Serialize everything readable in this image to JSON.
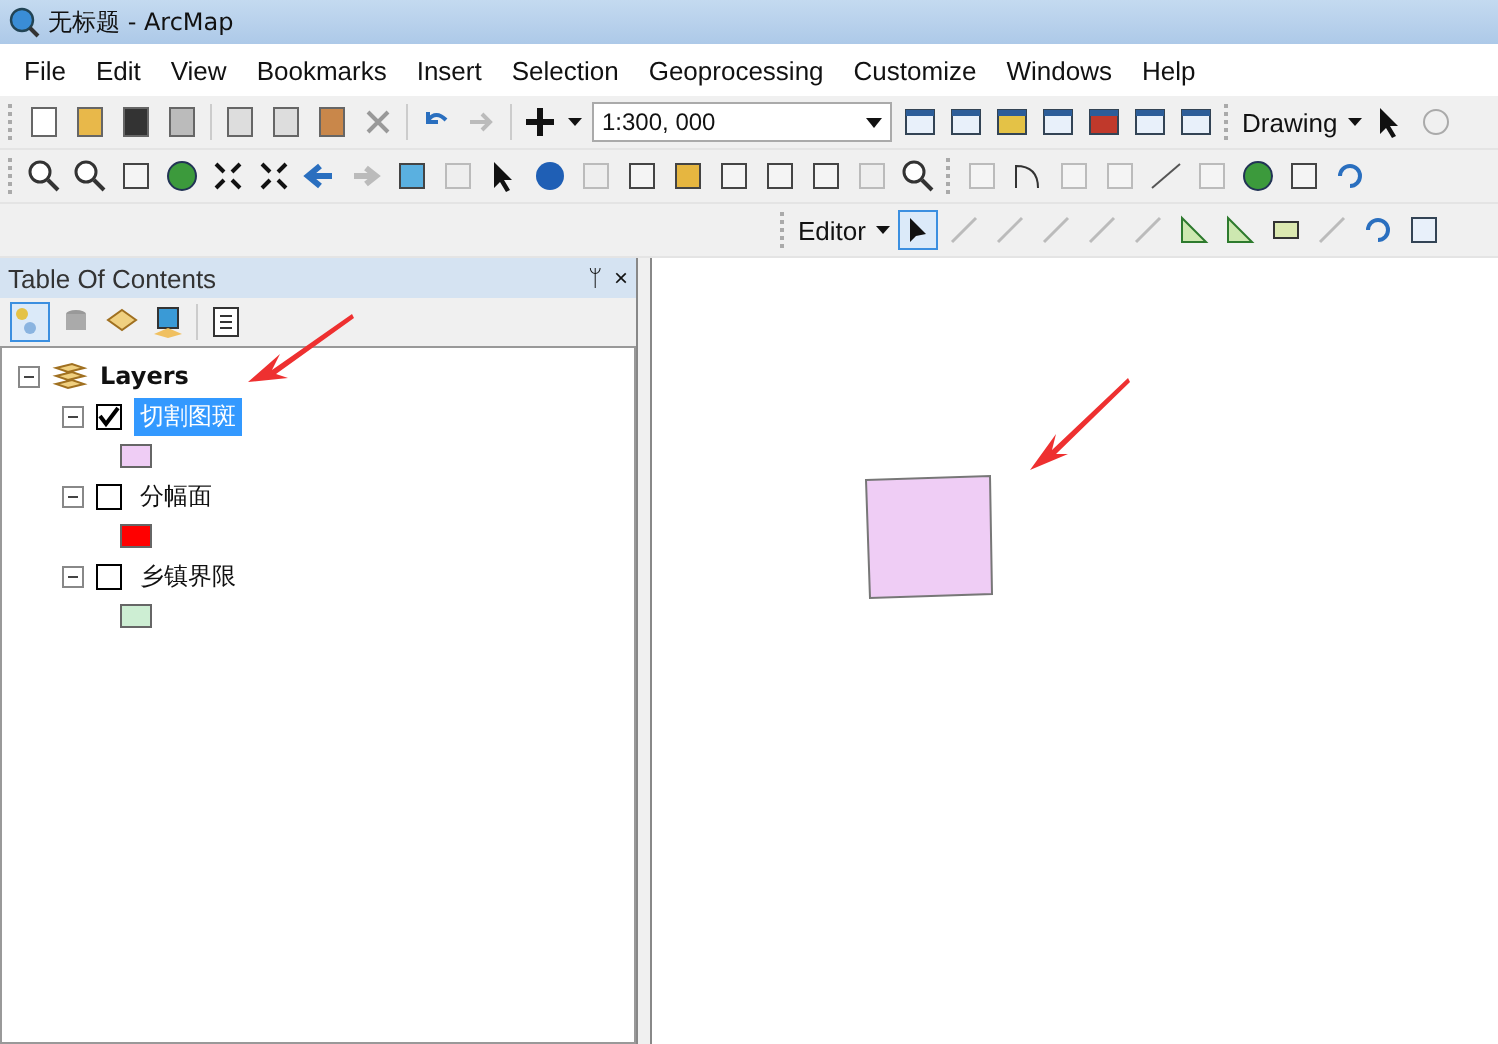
{
  "window": {
    "title": "无标题 - ArcMap"
  },
  "menu": [
    "File",
    "Edit",
    "View",
    "Bookmarks",
    "Insert",
    "Selection",
    "Geoprocessing",
    "Customize",
    "Windows",
    "Help"
  ],
  "scale_field": {
    "value": "1:300, 000"
  },
  "toolbars": {
    "drawing": "Drawing",
    "editor": "Editor"
  },
  "toc": {
    "title": "Table Of Contents",
    "pin": "ᛘ",
    "close": "×",
    "root": {
      "label": "Layers",
      "expanded": true,
      "children": [
        {
          "label": "切割图斑",
          "checked": true,
          "selected": true,
          "expanded": true,
          "color": "#efcdf5"
        },
        {
          "label": "分幅面",
          "checked": false,
          "selected": false,
          "expanded": true,
          "color": "#ff0000"
        },
        {
          "label": "乡镇界限",
          "checked": false,
          "selected": false,
          "expanded": true,
          "color": "#cdeed3"
        }
      ]
    }
  }
}
